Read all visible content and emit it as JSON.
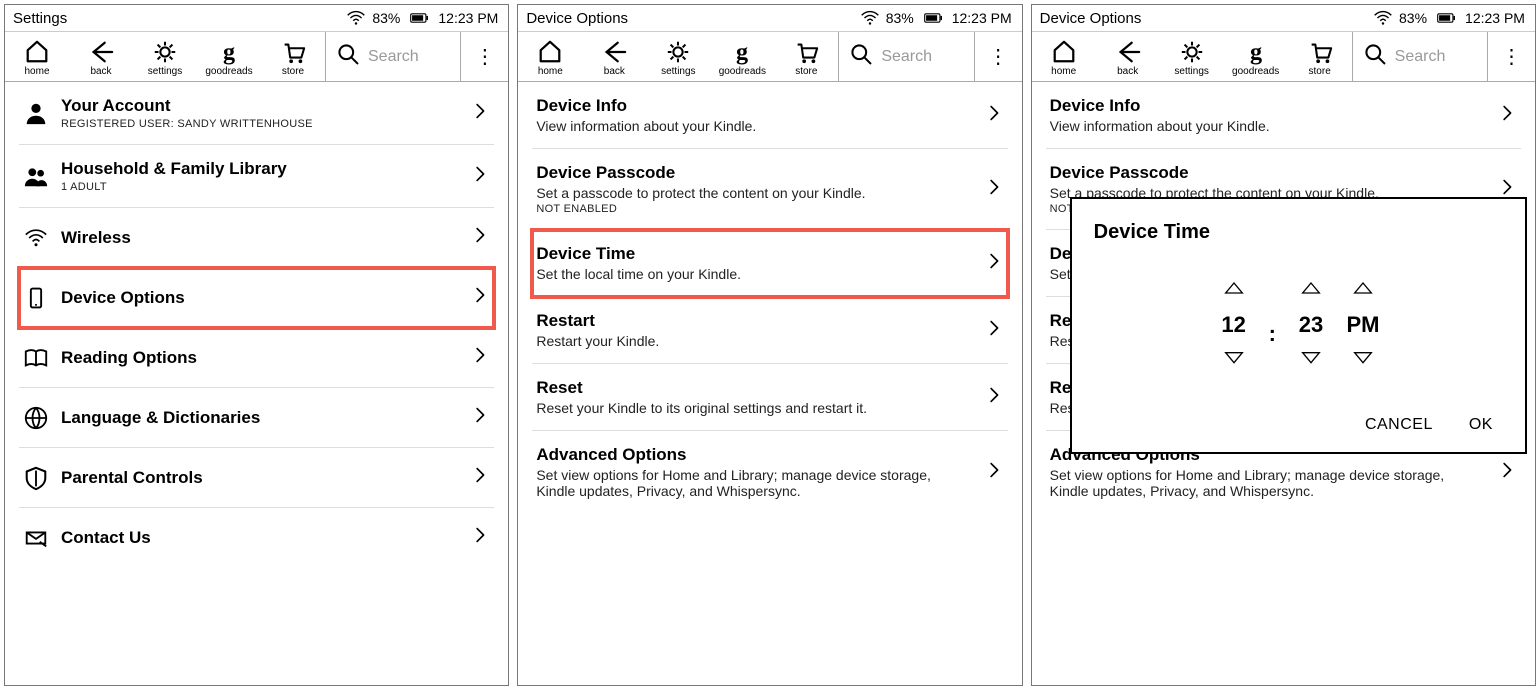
{
  "status": {
    "battery": "83%",
    "time": "12:23 PM"
  },
  "toolbar": {
    "home": "home",
    "back": "back",
    "settings": "settings",
    "goodreads": "goodreads",
    "store": "store",
    "search_placeholder": "Search"
  },
  "panel1": {
    "title": "Settings",
    "rows": [
      {
        "title": "Your Account",
        "meta": "REGISTERED USER: SANDY WRITTENHOUSE"
      },
      {
        "title": "Household & Family Library",
        "meta": "1 ADULT"
      },
      {
        "title": "Wireless"
      },
      {
        "title": "Device Options",
        "highlight": true
      },
      {
        "title": "Reading Options"
      },
      {
        "title": "Language & Dictionaries"
      },
      {
        "title": "Parental Controls"
      },
      {
        "title": "Contact Us"
      }
    ]
  },
  "panel2": {
    "title": "Device Options",
    "rows": [
      {
        "title": "Device Info",
        "sub": "View information about your Kindle."
      },
      {
        "title": "Device Passcode",
        "sub": "Set a passcode to protect the content on your Kindle.",
        "meta": "NOT ENABLED"
      },
      {
        "title": "Device Time",
        "sub": "Set the local time on your Kindle.",
        "highlight": true
      },
      {
        "title": "Restart",
        "sub": "Restart your Kindle."
      },
      {
        "title": "Reset",
        "sub": "Reset your Kindle to its original settings and restart it."
      },
      {
        "title": "Advanced Options",
        "sub": "Set view options for Home and Library; manage device storage, Kindle updates, Privacy, and Whispersync."
      }
    ]
  },
  "panel3": {
    "title": "Device Options",
    "dialog": {
      "title": "Device Time",
      "hour": "12",
      "minute": "23",
      "ampm": "PM",
      "cancel": "CANCEL",
      "ok": "OK"
    }
  }
}
